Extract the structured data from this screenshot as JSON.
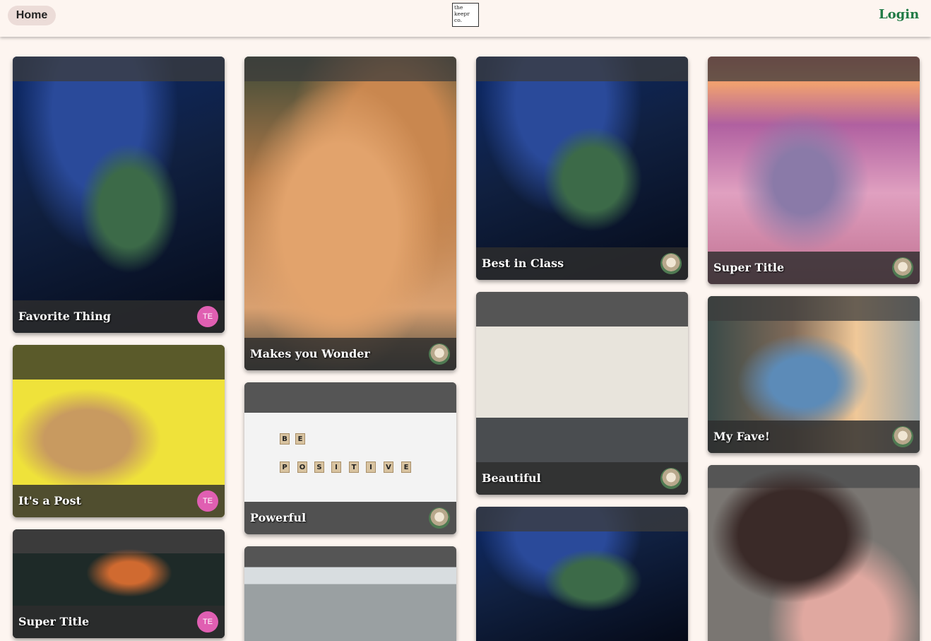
{
  "nav": {
    "home_label": "Home",
    "logo_lines": [
      "the",
      "keepr",
      "co."
    ],
    "login_label": "Login"
  },
  "cards": [
    {
      "title": "Favorite Thing",
      "avatar": "TE",
      "image": "retro-tv-stack-image"
    },
    {
      "title": "Makes you Wonder",
      "avatar": "",
      "image": "sleeping-cat-image"
    },
    {
      "title": "Best in Class",
      "avatar": "",
      "image": "retro-tv-stack-image"
    },
    {
      "title": "Super Title",
      "avatar": "",
      "image": "sunset-clouds-image"
    },
    {
      "title": "It's a Post",
      "avatar": "TE",
      "image": "dog-yellow-background-image"
    },
    {
      "title": "Powerful",
      "avatar": "",
      "image": "scrabble-tiles-image"
    },
    {
      "title": "Beautiful",
      "avatar": "",
      "image": "kitchen-image"
    },
    {
      "title": "My Fave!",
      "avatar": "",
      "image": "man-celebrating-image"
    },
    {
      "title": "Super Title",
      "avatar": "TE",
      "image": "bird-on-branch-image"
    },
    {
      "title": "",
      "avatar": "",
      "image": "mountains-image"
    },
    {
      "title": "",
      "avatar": "",
      "image": "retro-tv-neon-image"
    },
    {
      "title": "",
      "avatar": "",
      "image": "beanies-image"
    }
  ],
  "scrabble_words": [
    [
      "B",
      "E"
    ],
    [
      "P",
      "O",
      "S",
      "I",
      "T",
      "I",
      "V",
      "E"
    ]
  ],
  "colors": {
    "background": "#fdf5f0",
    "login": "#1f7a45",
    "home_pill": "#ecdcd8",
    "avatar_pink": "#e05fb2"
  }
}
